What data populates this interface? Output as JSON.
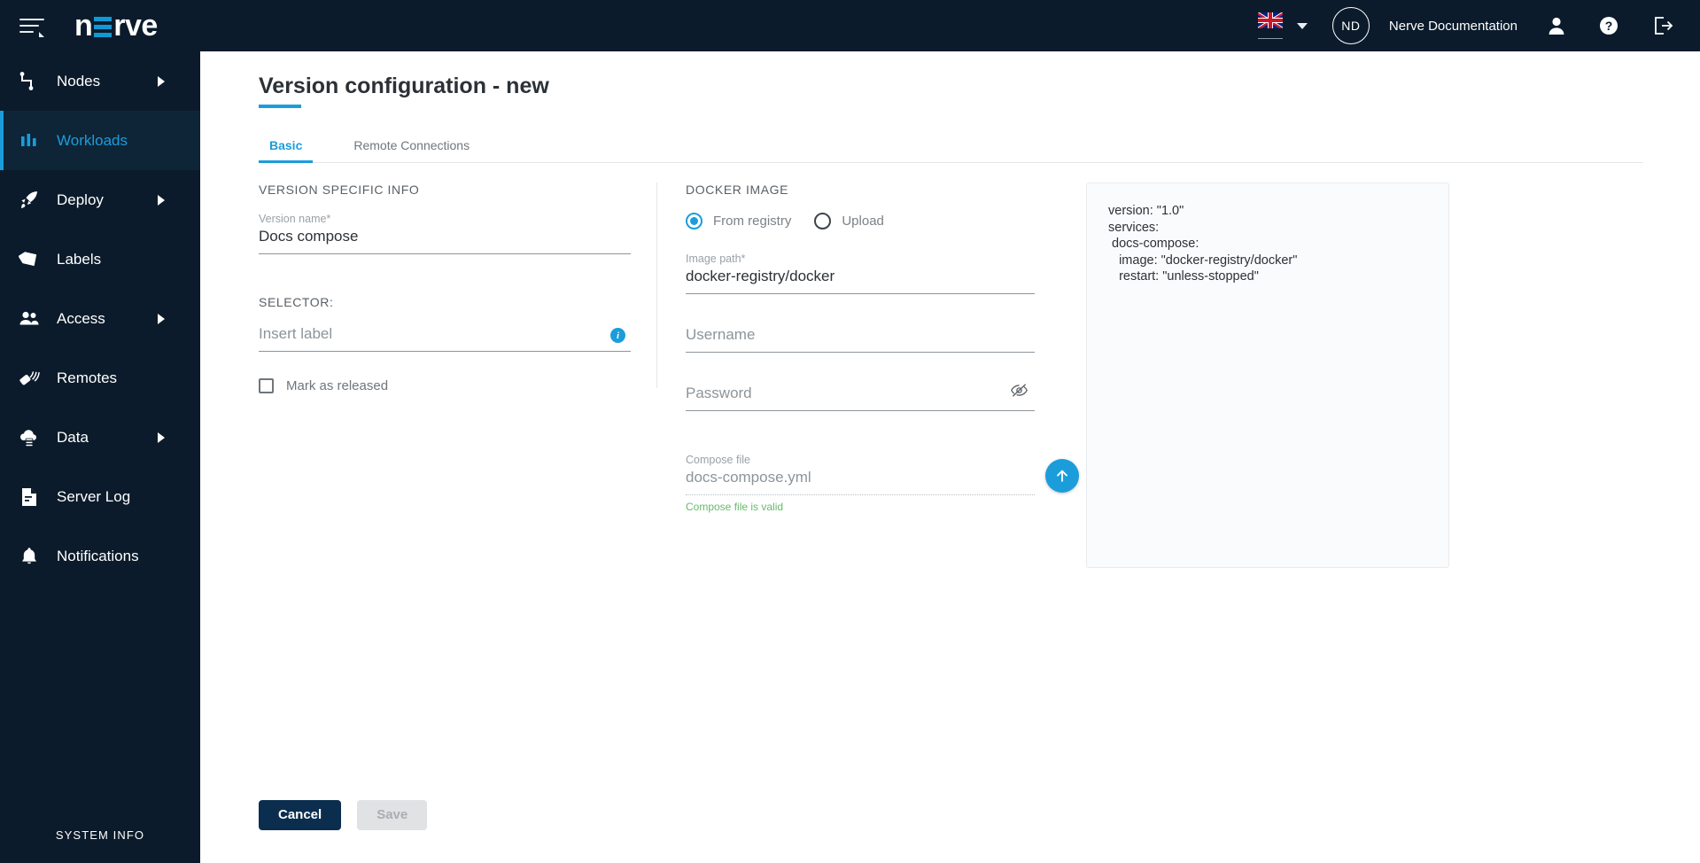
{
  "brand": {
    "name_part1": "n",
    "name_part2": "rve"
  },
  "topbar": {
    "language_flag": "uk-flag-icon",
    "language_caret": "chevron-down-icon",
    "avatar_initials": "ND",
    "username": "Nerve Documentation",
    "user_icon": "user-icon",
    "help_icon": "question-mark-icon",
    "logout_icon": "logout-icon",
    "menu_icon": "hamburger-menu-icon"
  },
  "sidebar": {
    "items": [
      {
        "label": "Nodes",
        "icon": "nodes-icon",
        "has_arrow": true,
        "active": false
      },
      {
        "label": "Workloads",
        "icon": "workloads-icon",
        "has_arrow": false,
        "active": true
      },
      {
        "label": "Deploy",
        "icon": "rocket-icon",
        "has_arrow": true,
        "active": false
      },
      {
        "label": "Labels",
        "icon": "labels-icon",
        "has_arrow": false,
        "active": false
      },
      {
        "label": "Access",
        "icon": "users-icon",
        "has_arrow": true,
        "active": false
      },
      {
        "label": "Remotes",
        "icon": "remote-icon",
        "has_arrow": false,
        "active": false
      },
      {
        "label": "Data",
        "icon": "cloud-data-icon",
        "has_arrow": true,
        "active": false
      },
      {
        "label": "Server Log",
        "icon": "document-icon",
        "has_arrow": false,
        "active": false
      },
      {
        "label": "Notifications",
        "icon": "bell-icon",
        "has_arrow": false,
        "active": false
      }
    ],
    "system_info": "SYSTEM INFO"
  },
  "page": {
    "title": "Version configuration - new",
    "tabs": [
      {
        "label": "Basic",
        "active": true
      },
      {
        "label": "Remote Connections",
        "active": false
      }
    ]
  },
  "version_specific_info": {
    "section_title": "VERSION SPECIFIC INFO",
    "version_name": {
      "label": "Version name*",
      "value": "Docs compose"
    },
    "selector": {
      "label": "SELECTOR:",
      "placeholder": "Insert label",
      "info_icon": "info-icon"
    },
    "mark_as_released": {
      "label": "Mark as released",
      "checked": false
    }
  },
  "docker_image": {
    "section_title": "DOCKER IMAGE",
    "source_options": [
      {
        "label": "From registry",
        "selected": true
      },
      {
        "label": "Upload",
        "selected": false
      }
    ],
    "image_path": {
      "label": "Image path*",
      "value": "docker-registry/docker"
    },
    "username": {
      "label": "",
      "placeholder": "Username",
      "value": ""
    },
    "password": {
      "label": "",
      "placeholder": "Password",
      "value": "",
      "toggle_icon": "eye-off-icon"
    },
    "compose_file": {
      "label": "Compose file",
      "value": "docs-compose.yml",
      "upload_icon": "upload-arrow-icon",
      "validation_message": "Compose file is valid"
    }
  },
  "yaml_preview": {
    "content": "version: \"1.0\"\nservices:\n docs-compose:\n   image: \"docker-registry/docker\"\n   restart: \"unless-stopped\""
  },
  "footer": {
    "cancel_label": "Cancel",
    "save_label": "Save"
  },
  "colors": {
    "brand_dark": "#0b1b2b",
    "accent_blue": "#1b9ddb",
    "cancel_navy": "#0b2e4f",
    "valid_green": "#64bb6a"
  }
}
